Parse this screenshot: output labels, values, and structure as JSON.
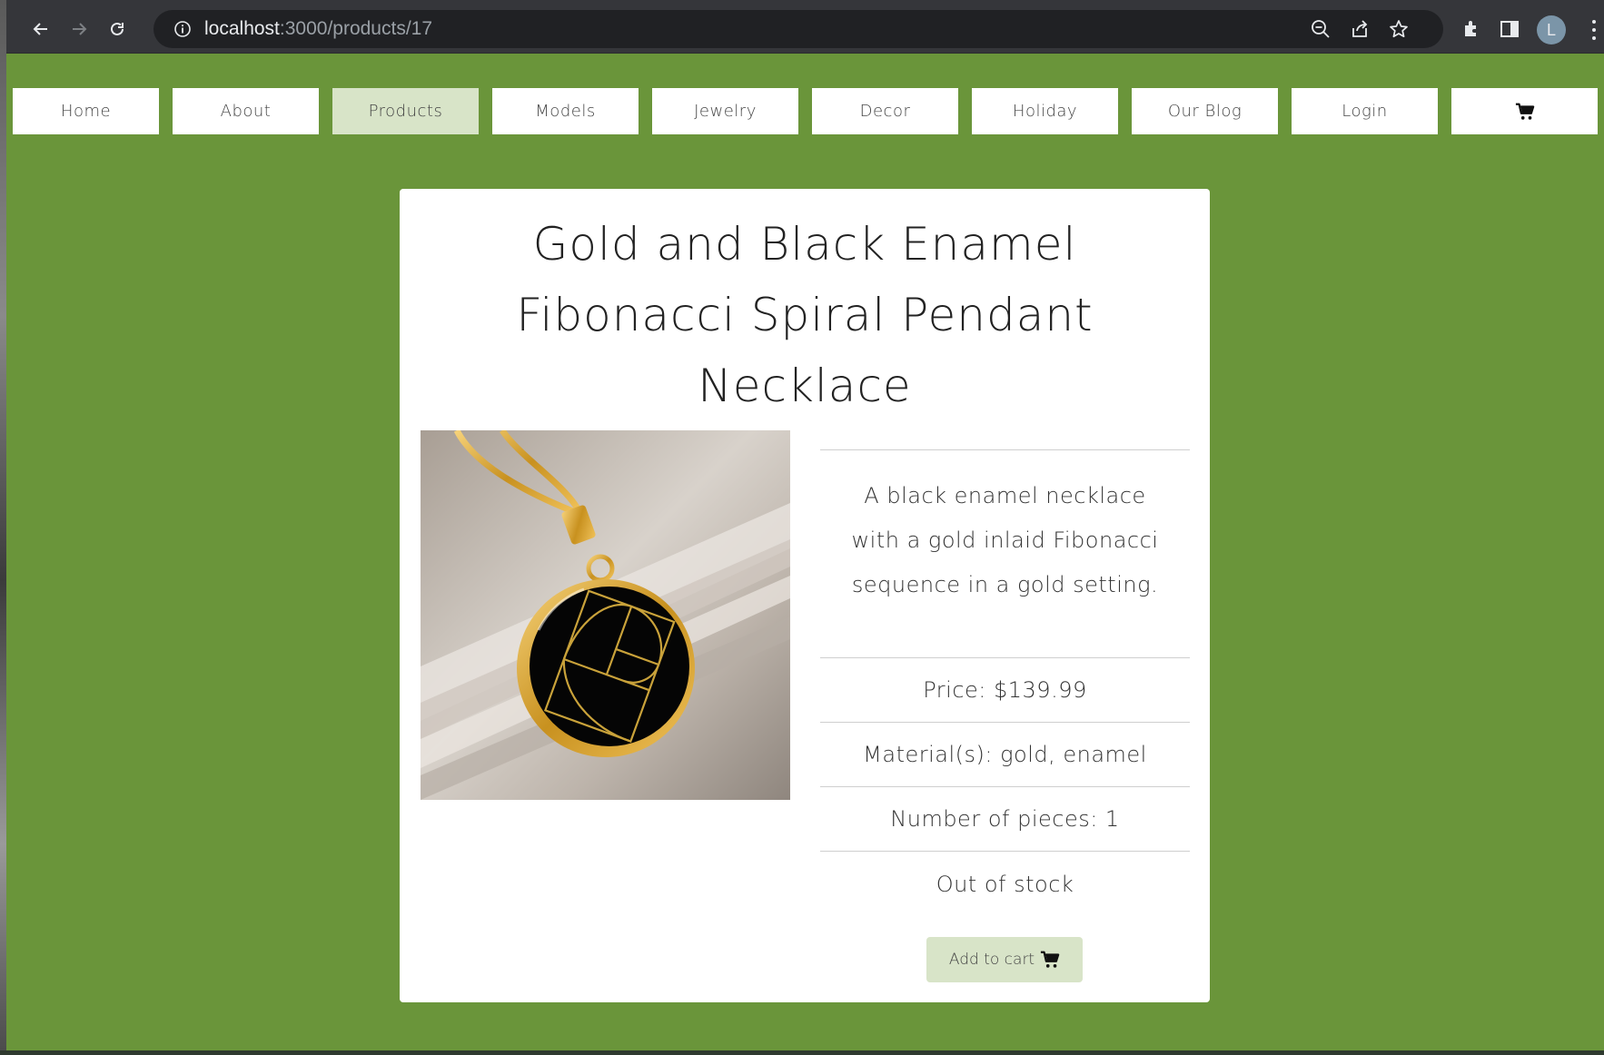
{
  "browser": {
    "url_host": "localhost",
    "url_path": ":3000/products/17",
    "profile_initial": "L"
  },
  "nav": {
    "items": [
      {
        "label": "Home"
      },
      {
        "label": "About"
      },
      {
        "label": "Products",
        "active": true
      },
      {
        "label": "Models"
      },
      {
        "label": "Jewelry"
      },
      {
        "label": "Decor"
      },
      {
        "label": "Holiday"
      },
      {
        "label": "Our Blog"
      },
      {
        "label": "Login"
      }
    ],
    "cart_icon": "shopping-cart-icon"
  },
  "product": {
    "title": "Gold and Black Enamel Fibonacci Spiral Pendant Necklace",
    "description": "A black enamel necklace with a gold inlaid Fibonacci sequence in a gold setting.",
    "price": "Price: $139.99",
    "materials": "Material(s): gold, enamel",
    "pieces": "Number of pieces: 1",
    "stock": "Out of stock",
    "add_to_cart_label": "Add to cart"
  },
  "colors": {
    "page_background": "#6a953a",
    "active_nav": "#d8e4c8",
    "button_background": "#d8e4c8",
    "chrome_toolbar": "#35363a"
  }
}
